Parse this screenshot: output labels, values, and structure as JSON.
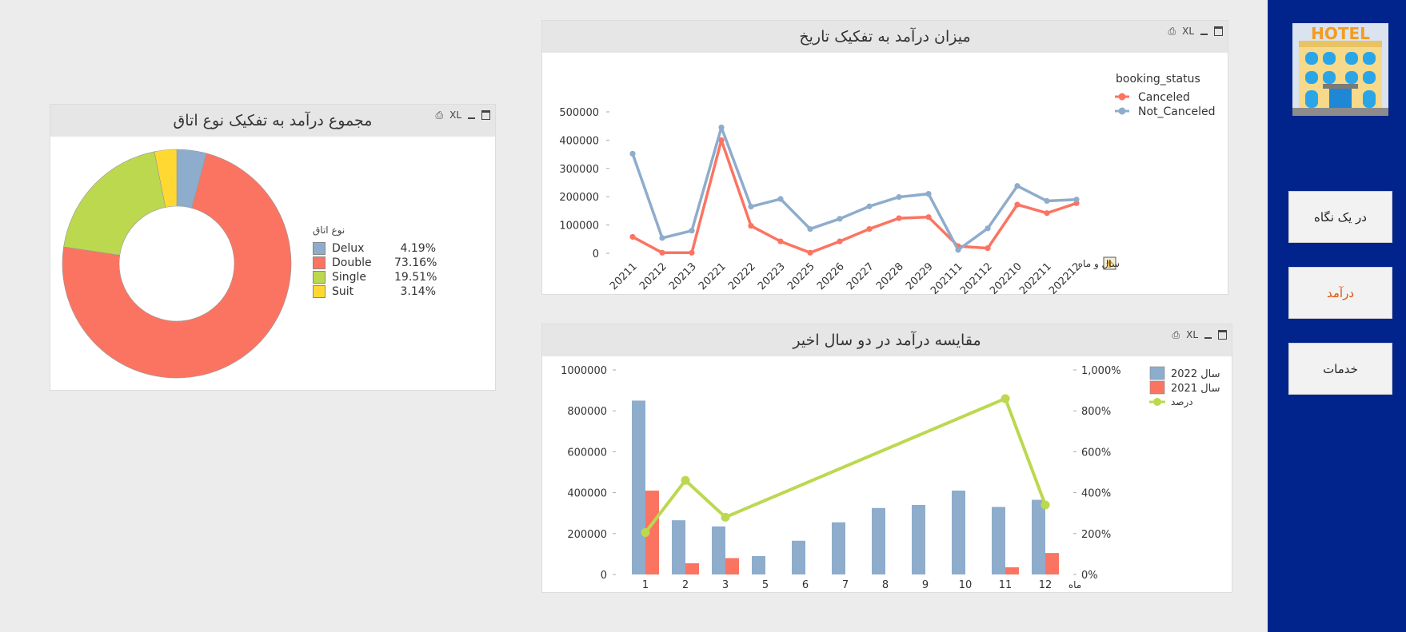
{
  "sidebar": {
    "logo_text": "HOTEL",
    "nav": [
      {
        "label": "در یک نگاه"
      },
      {
        "label": "درآمد"
      },
      {
        "label": "خدمات"
      }
    ]
  },
  "controls": {
    "xl": "XL"
  },
  "donut": {
    "title": "مجموع درآمد به تفکیک نوع اتاق",
    "chart_data": {
      "type": "pie",
      "legend_title": "نوع اتاق",
      "slices": [
        {
          "name": "Delux",
          "pct": "4.19%",
          "value": 4.19,
          "color": "#8eaccc"
        },
        {
          "name": "Double",
          "pct": "73.16%",
          "value": 73.16,
          "color": "#fb7462"
        },
        {
          "name": "Single",
          "pct": "19.51%",
          "value": 19.51,
          "color": "#bcd84f"
        },
        {
          "name": "Suit",
          "pct": "3.14%",
          "value": 3.14,
          "color": "#ffd932"
        }
      ]
    }
  },
  "line": {
    "title": "میزان درآمد به تفکیک تاریخ",
    "dim_label": "سال و ماه",
    "chart_data": {
      "type": "line",
      "legend_title": "booking_status",
      "categories": [
        "20211",
        "20212",
        "20213",
        "20221",
        "20222",
        "20223",
        "20225",
        "20226",
        "20227",
        "20228",
        "20229",
        "202111",
        "202112",
        "202210",
        "202211",
        "202212"
      ],
      "y_ticks": [
        "0",
        "100000",
        "200000",
        "300000",
        "400000",
        "500000"
      ],
      "ylim": [
        0,
        500000
      ],
      "series": [
        {
          "name": "Canceled",
          "color": "#fb7462",
          "values": [
            58000,
            2000,
            2000,
            400000,
            97000,
            42000,
            2000,
            42000,
            86000,
            124000,
            128000,
            25000,
            18000,
            172000,
            142000,
            177000
          ]
        },
        {
          "name": "Not_Canceled",
          "color": "#8eaccc",
          "values": [
            352000,
            54000,
            80000,
            445000,
            165000,
            192000,
            86000,
            122000,
            166000,
            199000,
            210000,
            12000,
            88000,
            238000,
            185000,
            190000
          ]
        }
      ]
    }
  },
  "bars": {
    "title": "مقایسه درآمد در دو سال اخیر",
    "x_axis_label": "ماه",
    "chart_data": {
      "type": "bar",
      "categories": [
        "1",
        "2",
        "3",
        "5",
        "6",
        "7",
        "8",
        "9",
        "10",
        "11",
        "12"
      ],
      "y_ticks": [
        "0",
        "200000",
        "400000",
        "600000",
        "800000",
        "1000000"
      ],
      "ylim": [
        0,
        1000000
      ],
      "y2_ticks": [
        "0%",
        "200%",
        "400%",
        "600%",
        "800%",
        "1,000%"
      ],
      "y2lim": [
        0,
        1000
      ],
      "series": [
        {
          "name": "سال 2022",
          "color": "#8eaccc",
          "values": [
            850000,
            265000,
            235000,
            90000,
            165000,
            255000,
            325000,
            340000,
            410000,
            330000,
            365000
          ]
        },
        {
          "name": "سال 2021",
          "color": "#fb7462",
          "values": [
            410000,
            55000,
            80000,
            0,
            0,
            0,
            0,
            0,
            0,
            35000,
            105000
          ]
        },
        {
          "name": "درصد",
          "color": "#bcd84f",
          "type": "line",
          "values": [
            205,
            460,
            280,
            null,
            null,
            null,
            null,
            null,
            null,
            860,
            340
          ]
        }
      ]
    }
  }
}
